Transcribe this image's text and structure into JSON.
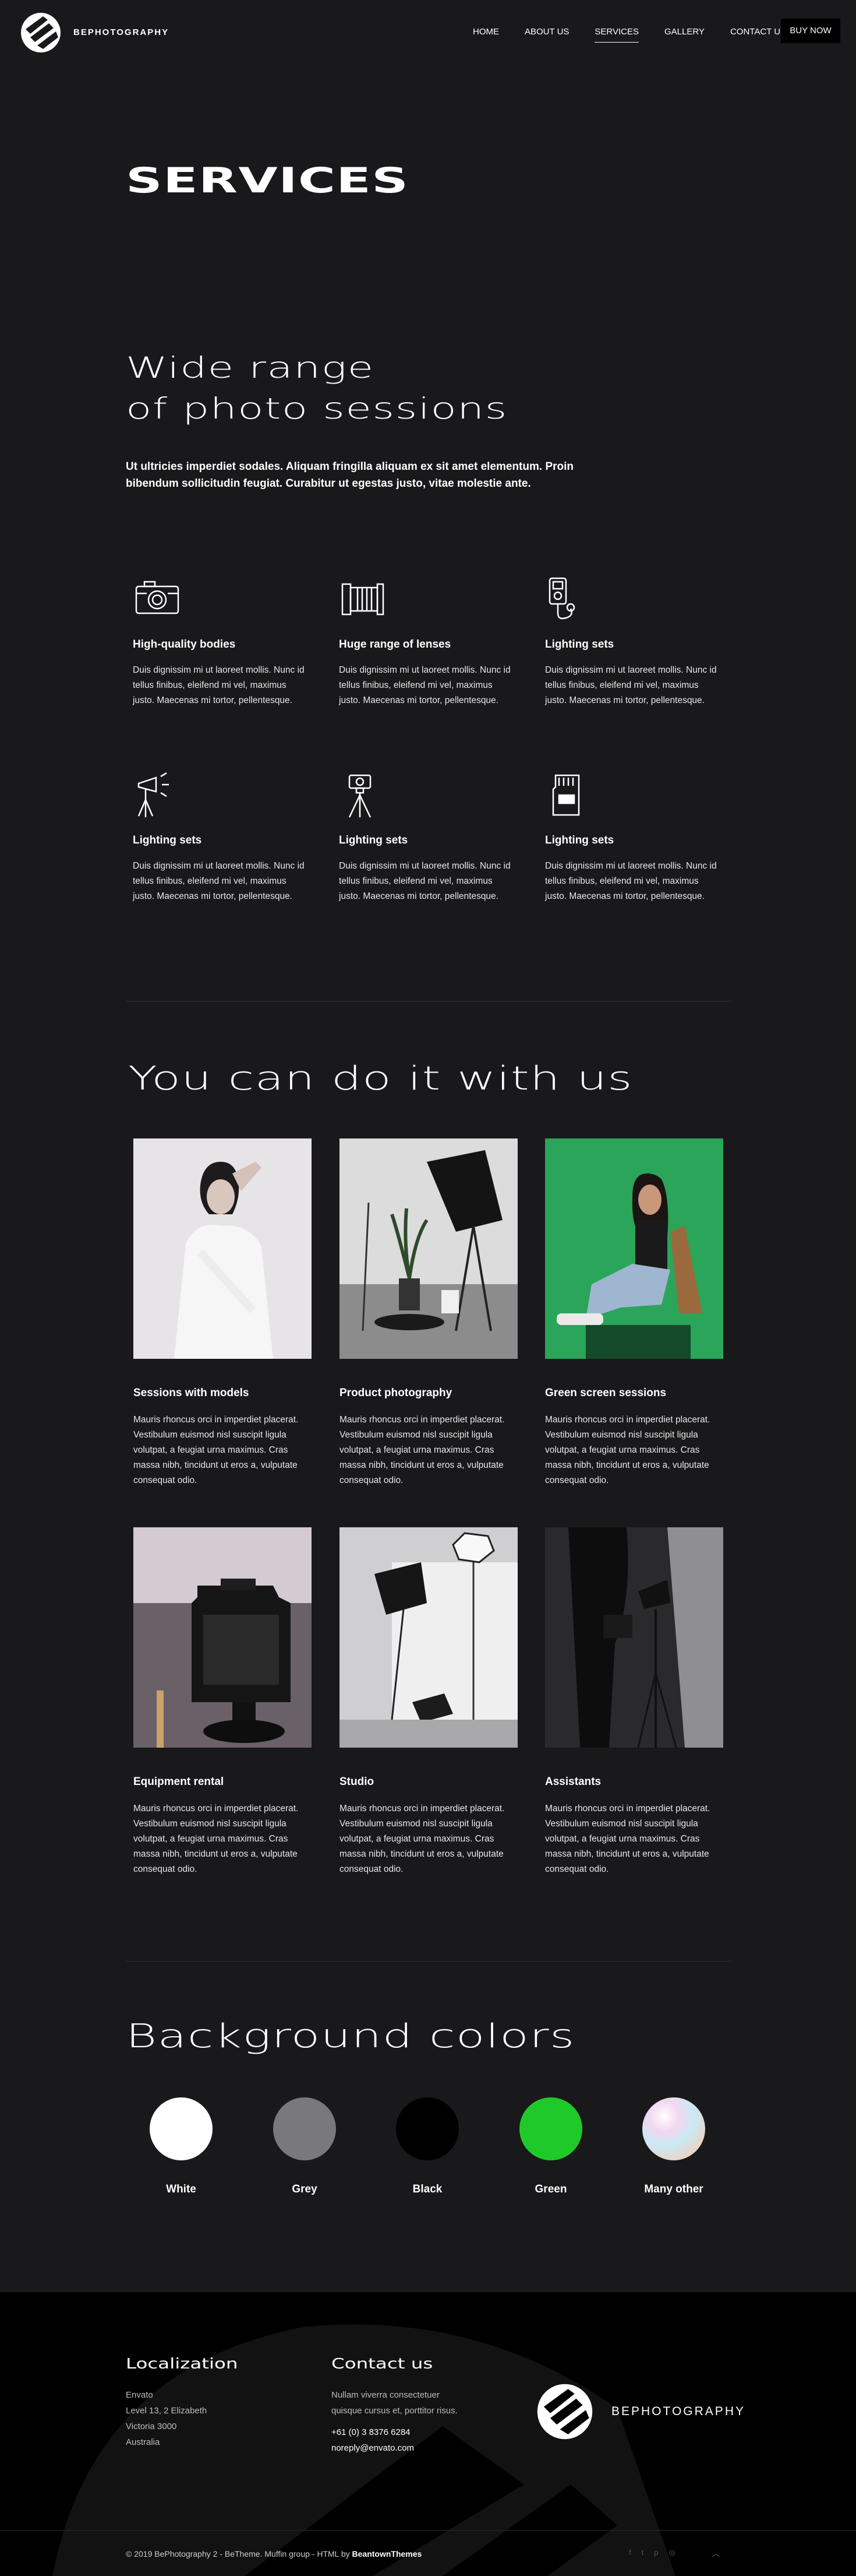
{
  "brand": {
    "name": "BEPHOTOGRAPHY"
  },
  "nav": {
    "items": [
      {
        "label": "HOME",
        "active": false
      },
      {
        "label": "ABOUT US",
        "active": false
      },
      {
        "label": "SERVICES",
        "active": true
      },
      {
        "label": "GALLERY",
        "active": false
      },
      {
        "label": "CONTACT US",
        "active": false
      }
    ],
    "buy_label": "BUY NOW"
  },
  "hero": {
    "title": "SERVICES",
    "subtitle_line1": "Wide range",
    "subtitle_line2": "of photo sessions",
    "intro": "Ut ultricies imperdiet sodales. Aliquam fringilla aliquam ex sit amet elementum. Proin bibendum sollicitudin feugiat. Curabitur ut egestas justo, vitae molestie ante."
  },
  "features": [
    {
      "icon": "camera-icon",
      "title": "High-quality bodies",
      "text": "Duis dignissim mi ut laoreet mollis. Nunc id tellus finibus, eleifend mi vel, maximus justo. Maecenas mi tortor, pellentesque."
    },
    {
      "icon": "lens-icon",
      "title": "Huge range of lenses",
      "text": "Duis dignissim mi ut laoreet mollis. Nunc id tellus finibus, eleifend mi vel, maximus justo. Maecenas mi tortor, pellentesque."
    },
    {
      "icon": "light-meter-icon",
      "title": "Lighting sets",
      "text": "Duis dignissim mi ut laoreet mollis. Nunc id tellus finibus, eleifend mi vel, maximus justo. Maecenas mi tortor, pellentesque."
    },
    {
      "icon": "studio-light-icon",
      "title": "Lighting sets",
      "text": "Duis dignissim mi ut laoreet mollis. Nunc id tellus finibus, eleifend mi vel, maximus justo. Maecenas mi tortor, pellentesque."
    },
    {
      "icon": "tripod-camera-icon",
      "title": "Lighting sets",
      "text": "Duis dignissim mi ut laoreet mollis. Nunc id tellus finibus, eleifend mi vel, maximus justo. Maecenas mi tortor, pellentesque."
    },
    {
      "icon": "memory-card-icon",
      "title": "Lighting sets",
      "text": "Duis dignissim mi ut laoreet mollis. Nunc id tellus finibus, eleifend mi vel, maximus justo. Maecenas mi tortor, pellentesque."
    }
  ],
  "with_us": {
    "title": "You can do it with us",
    "cards": [
      {
        "title": "Sessions with models",
        "text": "Mauris rhoncus orci in imperdiet placerat. Vestibulum euismod nisl suscipit ligula volutpat, a feugiat urna maximus. Cras massa nibh, tincidunt ut eros a, vulputate consequat odio."
      },
      {
        "title": "Product photography",
        "text": "Mauris rhoncus orci in imperdiet placerat. Vestibulum euismod nisl suscipit ligula volutpat, a feugiat urna maximus. Cras massa nibh, tincidunt ut eros a, vulputate consequat odio."
      },
      {
        "title": "Green screen sessions",
        "text": "Mauris rhoncus orci in imperdiet placerat. Vestibulum euismod nisl suscipit ligula volutpat, a feugiat urna maximus. Cras massa nibh, tincidunt ut eros a, vulputate consequat odio."
      },
      {
        "title": "Equipment rental",
        "text": "Mauris rhoncus orci in imperdiet placerat. Vestibulum euismod nisl suscipit ligula volutpat, a feugiat urna maximus. Cras massa nibh, tincidunt ut eros a, vulputate consequat odio."
      },
      {
        "title": "Studio",
        "text": "Mauris rhoncus orci in imperdiet placerat. Vestibulum euismod nisl suscipit ligula volutpat, a feugiat urna maximus. Cras massa nibh, tincidunt ut eros a, vulputate consequat odio."
      },
      {
        "title": "Assistants",
        "text": "Mauris rhoncus orci in imperdiet placerat. Vestibulum euismod nisl suscipit ligula volutpat, a feugiat urna maximus. Cras massa nibh, tincidunt ut eros a, vulputate consequat odio."
      }
    ]
  },
  "backgrounds": {
    "title": "Background colors",
    "items": [
      {
        "label": "White",
        "color": "#ffffff"
      },
      {
        "label": "Grey",
        "color": "#78787d"
      },
      {
        "label": "Black",
        "color": "#000000"
      },
      {
        "label": "Green",
        "color": "#1fc929"
      },
      {
        "label": "Many other",
        "color": "iridescent"
      }
    ]
  },
  "footer": {
    "localization_title": "Localization",
    "address": [
      "Envato",
      "Level 13, 2 Elizabeth",
      "Victoria 3000",
      "Australia"
    ],
    "contact_title": "Contact us",
    "contact_text": [
      "Nullam viverra consectetuer",
      "quisque cursus et, porttitor risus."
    ],
    "phone": "+61 (0) 3 8376 6284",
    "email": "noreply@envato.com",
    "brand": "BEPHOTOGRAPHY",
    "copyright": "© 2019 BePhotography 2 - BeTheme. Muffin group - HTML by",
    "copyright_link": "BeantownThemes",
    "social_icons": [
      "facebook-icon",
      "twitter-icon",
      "pinterest-icon",
      "instagram-icon"
    ]
  }
}
